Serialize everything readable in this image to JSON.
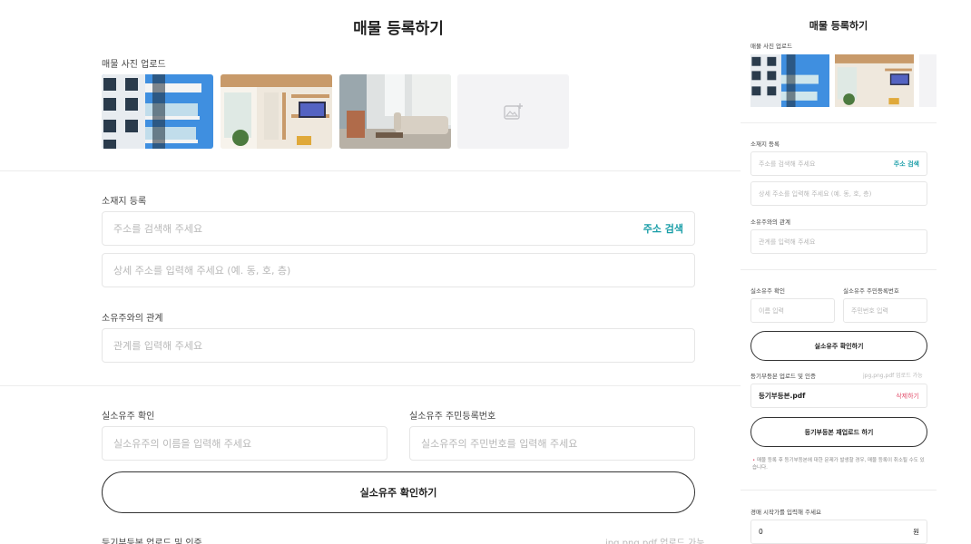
{
  "title": "매물 등록하기",
  "photos": {
    "label": "매물 사진 업로드",
    "items": [
      "building-exterior",
      "living-room-loft",
      "living-room-sofa"
    ],
    "add_icon": "add-photo-icon"
  },
  "location": {
    "label": "소재지 등록",
    "address_placeholder": "주소를 검색해 주세요",
    "search_button": "주소 검색",
    "detail_placeholder": "상세 주소를 입력해 주세요 (예. 동, 호, 층)"
  },
  "relation": {
    "label": "소유주와의 관계",
    "placeholder": "관계를 입력해 주세요"
  },
  "owner": {
    "name_label": "실소유주 확인",
    "name_placeholder": "실소유주의 이름을 입력해 주세요",
    "id_label": "실소유주 주민등록번호",
    "id_placeholder": "실소유주의 주민번호를 입력해 주세요",
    "verify_button": "실소유주 확인하기"
  },
  "registry": {
    "label": "등기부등본 업로드 및 인증",
    "hint": "jpg,png,pdf 업로드 가능"
  },
  "side": {
    "title": "매물 등록하기",
    "photo_label": "매물 사진 업로드",
    "location_label": "소재지 등록",
    "address_placeholder": "주소를 검색해 주세요",
    "search_button": "주소 검색",
    "detail_placeholder": "상세 주소를 입력해 주세요 (예. 동, 호, 층)",
    "relation_label": "소유주와의 관계",
    "relation_placeholder": "관계를 입력해 주세요",
    "owner_name_label": "실소유주 확인",
    "owner_name_placeholder": "이름 입력",
    "owner_id_label": "실소유주 주민등록번호",
    "owner_id_placeholder": "주민번호 입력",
    "verify_button": "실소유주 확인하기",
    "registry_label": "등기부등본 업로드 및 인증",
    "registry_hint": "jpg,png,pdf 업로드 가능",
    "file_name": "등기부등본.pdf",
    "delete_button": "삭제하기",
    "reupload_button": "등기부등본 재업로드 하기",
    "note": "매물 등록 후 등기부등본에 대한 문제가 발생할 경우, 매물 등록이 취소될 수도 있습니다.",
    "price_label": "경매 시작가를 입력해 주세요",
    "price_value": "0",
    "price_unit": "원"
  },
  "colors": {
    "accent": "#1a9ea8",
    "danger": "#e24e6b",
    "border": "#e6e6e6",
    "placeholder": "#b8b8b8"
  }
}
